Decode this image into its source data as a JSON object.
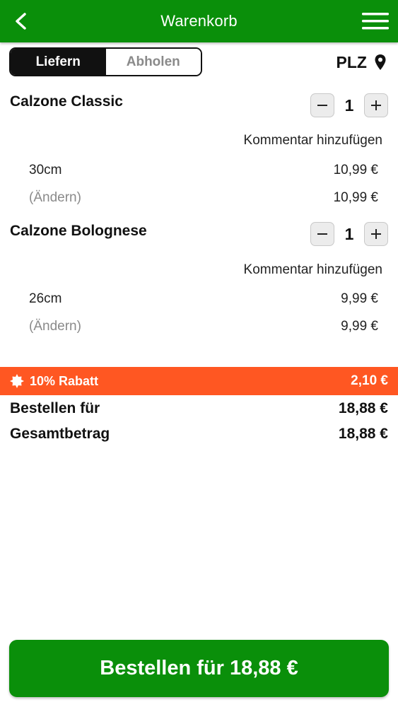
{
  "header": {
    "title": "Warenkorb",
    "back_icon": "chevron-left-icon",
    "menu_icon": "hamburger-menu-icon"
  },
  "delivery_toggle": {
    "options": [
      "Liefern",
      "Abholen"
    ],
    "selected": "Liefern"
  },
  "location": {
    "label": "PLZ",
    "icon": "map-pin-icon"
  },
  "items": [
    {
      "name": "Calzone Classic",
      "quantity": "1",
      "comment_label": "Kommentar hinzufügen",
      "size": "30cm",
      "size_price": "10,99 €",
      "change_label": "(Ändern)",
      "total_price": "10,99 €"
    },
    {
      "name": "Calzone Bolognese",
      "quantity": "1",
      "comment_label": "Kommentar hinzufügen",
      "size": "26cm",
      "size_price": "9,99 €",
      "change_label": "(Ändern)",
      "total_price": "9,99 €"
    }
  ],
  "discount": {
    "label": "10% Rabatt",
    "amount": "2,10 €",
    "icon": "badge-icon",
    "color": "#ff5722"
  },
  "totals": {
    "order_for_label": "Bestellen für",
    "order_for_value": "18,88 €",
    "total_label": "Gesamtbetrag",
    "total_value": "18,88 €"
  },
  "order_button": {
    "label": "Bestellen für 18,88 €"
  },
  "colors": {
    "brand_green": "#0a8f0a",
    "discount_orange": "#ff5722"
  }
}
